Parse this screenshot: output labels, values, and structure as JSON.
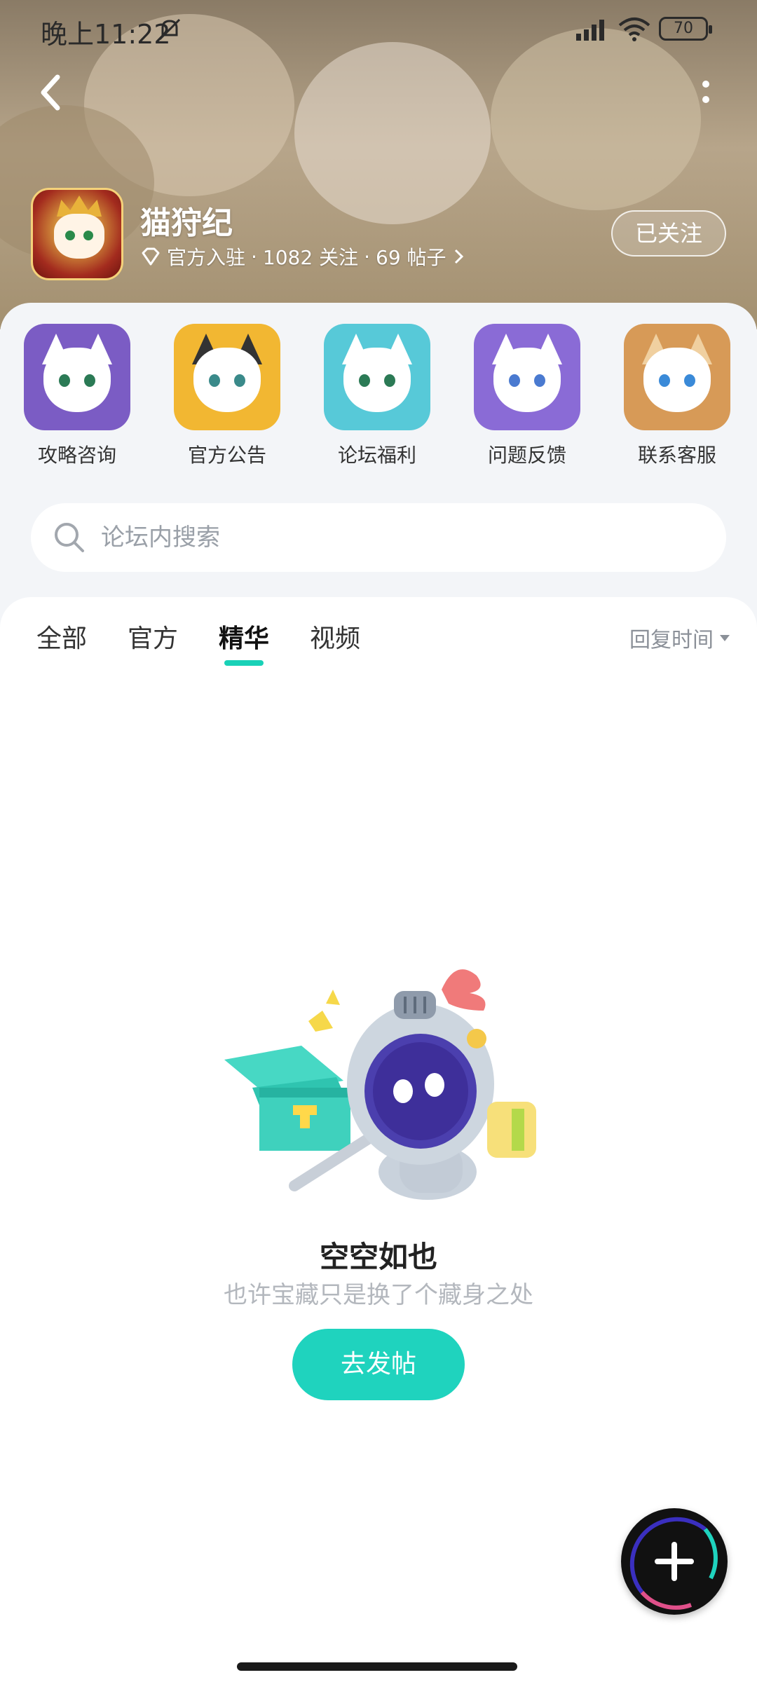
{
  "status_bar": {
    "time": "晚上11:22",
    "battery": "70"
  },
  "forum": {
    "name": "猫狩纪",
    "badge": "官方入驻",
    "followers": "1082 关注",
    "posts": "69 帖子",
    "separator": "·",
    "follow_label": "已关注"
  },
  "quick_links": [
    {
      "label": "攻略咨询",
      "bg": "#7b5cc4"
    },
    {
      "label": "官方公告",
      "bg": "#f2b732"
    },
    {
      "label": "论坛福利",
      "bg": "#57c9d8"
    },
    {
      "label": "问题反馈",
      "bg": "#8a6bd6"
    },
    {
      "label": "联系客服",
      "bg": "#d79a57"
    }
  ],
  "search": {
    "placeholder": "论坛内搜索"
  },
  "tabs": [
    {
      "label": "全部"
    },
    {
      "label": "官方"
    },
    {
      "label": "精华",
      "active": true
    },
    {
      "label": "视频"
    }
  ],
  "sort": {
    "label": "回复时间"
  },
  "empty_state": {
    "title": "空空如也",
    "subtitle": "也许宝藏只是换了个藏身之处",
    "button": "去发帖"
  },
  "colors": {
    "accent": "#1fd3be",
    "fab": "#111111"
  },
  "icons": [
    "bell-off-icon",
    "signal-icon",
    "wifi-icon",
    "back-icon",
    "more-icon",
    "diamond-icon",
    "chevron-right-icon",
    "search-icon",
    "triangle-down-icon",
    "plus-icon"
  ]
}
